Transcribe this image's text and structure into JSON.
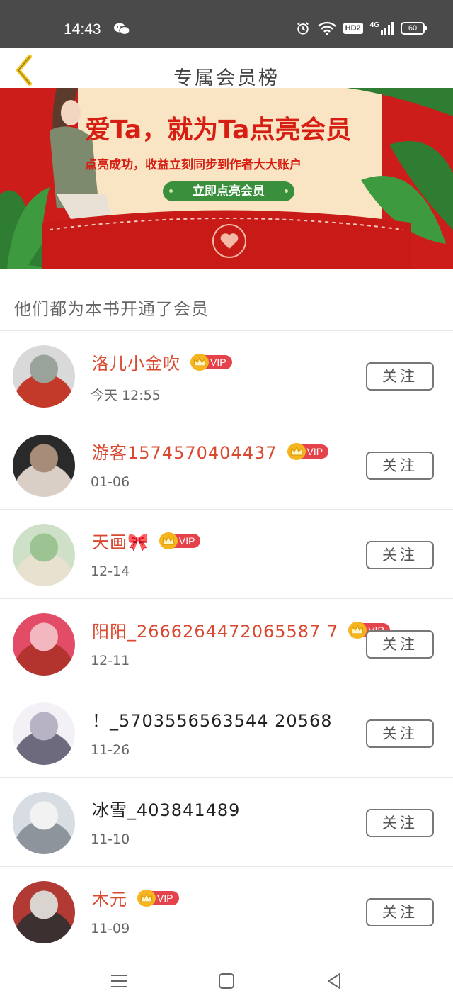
{
  "status_bar": {
    "time": "14:43",
    "icons": [
      "wechat-icon",
      "alarm-icon",
      "wifi-icon",
      "hd-icon",
      "signal-4g-icon",
      "battery-icon"
    ],
    "hd_label": "HD2",
    "network_label": "4G",
    "battery": "60"
  },
  "header": {
    "title": "专属会员榜",
    "back_icon": "chevron-left-icon",
    "accent": "#f2c31b"
  },
  "banner": {
    "title": "爱Ta，就为Ta点亮会员",
    "subtitle": "点亮成功，收益立刻同步到作者大大账户",
    "cta_label": "立即点亮会员",
    "colors": {
      "background": "#cc1d1a",
      "card": "#f9e5c4",
      "button": "#3a8f3c"
    }
  },
  "list_heading": "他们都为本书开通了会员",
  "vip_label": "VIP",
  "follow_label": "关注",
  "members": [
    {
      "name": "洛儿小金吹",
      "date": "今天 12:55",
      "vip": true,
      "avatar_colors": [
        "#d9d9d9",
        "#9aa39a",
        "#c43a2a"
      ]
    },
    {
      "name": "游客1574570404437",
      "date": "01-06",
      "vip": true,
      "avatar_colors": [
        "#2a2a2a",
        "#a88c7a",
        "#d9cfc6"
      ]
    },
    {
      "name": "天画🎀",
      "date": "12-14",
      "vip": true,
      "avatar_colors": [
        "#cfe0c8",
        "#9cc493",
        "#e9e1d0"
      ]
    },
    {
      "name": "阳阳_2666264472065587 7",
      "date": "12-11",
      "vip": true,
      "avatar_colors": [
        "#e24c67",
        "#f3b7c0",
        "#b3332f"
      ]
    },
    {
      "name": "！_5703556563544 20568",
      "date": "11-26",
      "vip": false,
      "avatar_colors": [
        "#f3f1f5",
        "#b7b2c4",
        "#6e6a7e"
      ]
    },
    {
      "name": "冰雪_403841489",
      "date": "11-10",
      "vip": false,
      "avatar_colors": [
        "#d7dde3",
        "#f2f2f2",
        "#8d949b"
      ]
    },
    {
      "name": "木元",
      "date": "11-09",
      "vip": true,
      "avatar_colors": [
        "#b23a34",
        "#d9d4d0",
        "#3c3030"
      ]
    }
  ],
  "nav": {
    "menu_icon": "menu-icon",
    "home_icon": "square-home-icon",
    "back_icon": "triangle-back-icon"
  }
}
